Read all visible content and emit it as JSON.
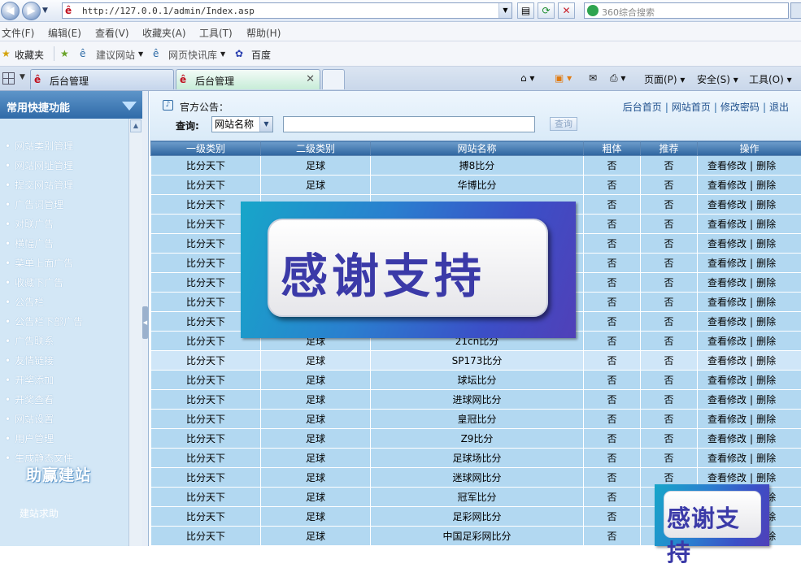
{
  "browser": {
    "url": "http://127.0.0.1/admin/Index.asp",
    "search_placeholder": "360综合搜索",
    "menu": [
      "文件(F)",
      "编辑(E)",
      "查看(V)",
      "收藏夹(A)",
      "工具(T)",
      "帮助(H)"
    ],
    "favorites": {
      "label": "收藏夹",
      "items": [
        "建议网站",
        "网页快讯库",
        "百度"
      ]
    },
    "tabs": [
      "后台管理",
      "后台管理"
    ],
    "commands": {
      "page": "页面(P)",
      "safety": "安全(S)",
      "tools": "工具(O)"
    }
  },
  "sidebar": {
    "title": "常用快捷功能",
    "items": [
      "网站类别管理",
      "网站网址管理",
      "提交网站管理",
      "广告词管理",
      "对联广告",
      "横幅广告",
      "菜单上面广告",
      "收藏下广告",
      "公告栏",
      "公告栏下部广告",
      "广告联系",
      "友情链接",
      "开奖添加",
      "开奖查看",
      "网站设置",
      "用户管理",
      "生成静态文件"
    ],
    "brand": "助赢建站",
    "help": "建站求助"
  },
  "main": {
    "notice": "官方公告：",
    "links": [
      "后台首页",
      "网站首页",
      "修改密码",
      "退出"
    ],
    "query_label": "查询:",
    "query_field": "网站名称",
    "query_button": "查询",
    "columns": [
      "一级类别",
      "二级类别",
      "网站名称",
      "粗体",
      "推荐",
      "操作"
    ],
    "edit_label": "查看修改",
    "delete_label": "删除",
    "rows": [
      [
        "比分天下",
        "足球",
        "搏8比分",
        "否",
        "否"
      ],
      [
        "比分天下",
        "足球",
        "华博比分",
        "否",
        "否"
      ],
      [
        "比分天下",
        "",
        "",
        "否",
        "否"
      ],
      [
        "比分天下",
        "",
        "",
        "否",
        "否"
      ],
      [
        "比分天下",
        "",
        "",
        "否",
        "否"
      ],
      [
        "比分天下",
        "",
        "",
        "否",
        "否"
      ],
      [
        "比分天下",
        "",
        "",
        "否",
        "否"
      ],
      [
        "比分天下",
        "",
        "",
        "否",
        "否"
      ],
      [
        "比分天下",
        "",
        "",
        "否",
        "否"
      ],
      [
        "比分天下",
        "足球",
        "21cn比分",
        "否",
        "否"
      ],
      [
        "比分天下",
        "足球",
        "SP173比分",
        "否",
        "否"
      ],
      [
        "比分天下",
        "足球",
        "球坛比分",
        "否",
        "否"
      ],
      [
        "比分天下",
        "足球",
        "进球网比分",
        "否",
        "否"
      ],
      [
        "比分天下",
        "足球",
        "皇冠比分",
        "否",
        "否"
      ],
      [
        "比分天下",
        "足球",
        "Z9比分",
        "否",
        "否"
      ],
      [
        "比分天下",
        "足球",
        "足球场比分",
        "否",
        "否"
      ],
      [
        "比分天下",
        "足球",
        "迷球网比分",
        "否",
        "否"
      ],
      [
        "比分天下",
        "足球",
        "冠军比分",
        "否",
        "否"
      ],
      [
        "比分天下",
        "足球",
        "足彩网比分",
        "否",
        "否"
      ],
      [
        "比分天下",
        "足球",
        "中国足彩网比分",
        "否",
        "否"
      ]
    ],
    "highlight_row": 10
  },
  "overlay": {
    "banner_text": "感谢支持"
  }
}
